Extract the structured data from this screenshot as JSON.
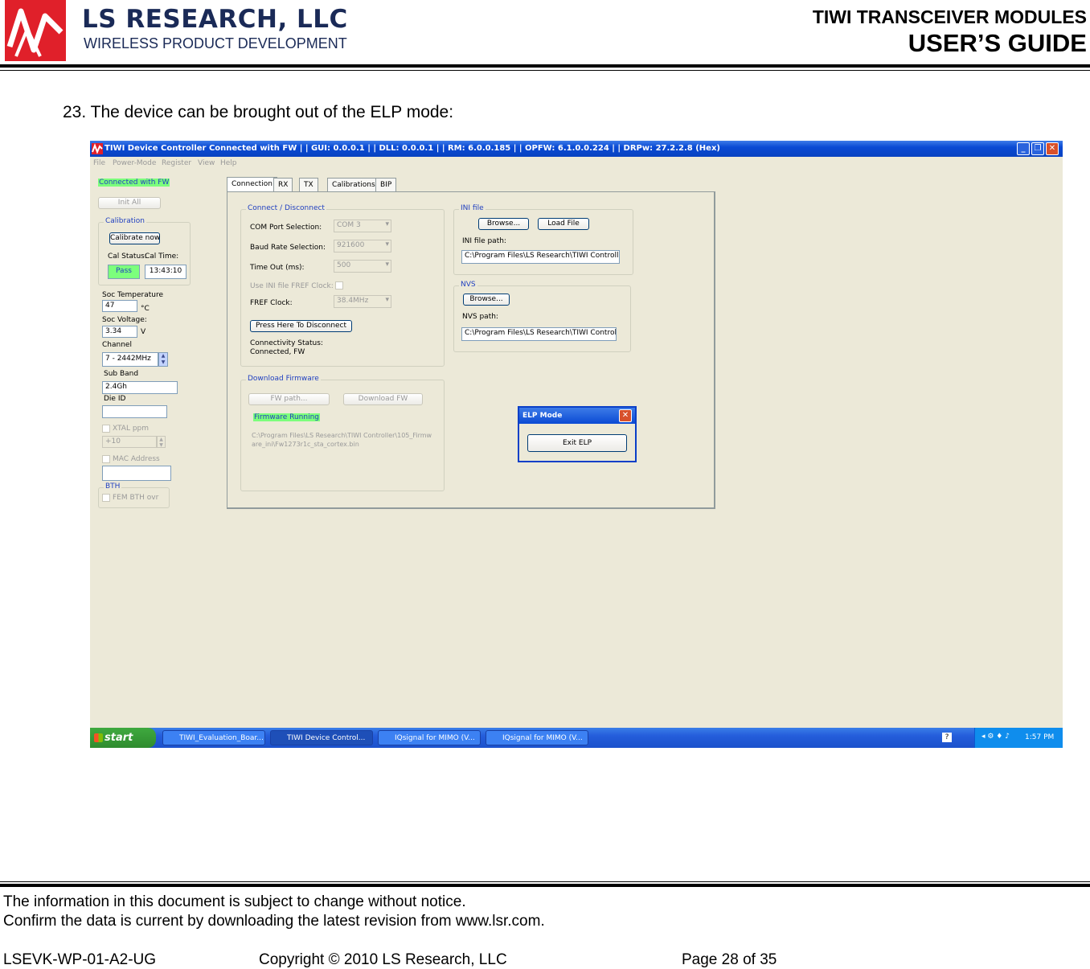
{
  "header": {
    "company": "LS RESEARCH, LLC",
    "tagline": "WIRELESS PRODUCT DEVELOPMENT",
    "title": "TIWI TRANSCEIVER MODULES",
    "subtitle": "USER’S GUIDE",
    "logo_icon": "ls-research-logo",
    "logo_color": "#e0202a"
  },
  "step": "23. The device can be brought out of the ELP mode:",
  "app": {
    "window_title": "TIWI Device Controller Connected with FW | | GUI: 0.0.0.1 | | DLL: 0.0.0.1 | | RM: 6.0.0.185 | | OPFW: 6.1.0.0.224 | | DRPw: 27.2.2.8 (Hex)",
    "menu": [
      "File",
      "Power-Mode",
      "Register",
      "View",
      "Help"
    ],
    "left": {
      "status": "Connected with FW",
      "init_all": "Init All",
      "calibration_group": "Calibration",
      "calibrate_now": "Calibrate now",
      "cal_status_label": "Cal Status:",
      "cal_time_label": "Cal Time:",
      "cal_status": "Pass",
      "cal_time": "13:43:10",
      "soc_temp_label": "Soc Temperature",
      "soc_temp": "47",
      "soc_temp_unit": "°C",
      "soc_voltage_label": "Soc Voltage:",
      "soc_voltage": "3.34",
      "soc_voltage_unit": "V",
      "channel_label": "Channel",
      "channel": "7 - 2442MHz",
      "subband_label": "Sub Band",
      "subband": "2.4Gh",
      "dieid_label": "Die ID",
      "xtal_label": "XTAL ppm",
      "xtal": "+10",
      "mac_label": "MAC Address",
      "bth_group": "BTH",
      "fem_label": "FEM BTH ovr"
    },
    "tabs": [
      "Connection",
      "RX",
      "TX",
      "Calibrations",
      "BIP"
    ],
    "connect": {
      "group": "Connect / Disconnect",
      "com_label": "COM Port Selection:",
      "com": "COM 3",
      "baud_label": "Baud Rate Selection:",
      "baud": "921600",
      "timeout_label": "Time Out (ms):",
      "timeout": "500",
      "ini_fref_label": "Use INI file FREF Clock:",
      "fref_label": "FREF Clock:",
      "fref": "38.4MHz",
      "disconnect_btn": "Press Here To Disconnect",
      "conn_status_label": "Connectivity Status:",
      "conn_status": "Connected, FW"
    },
    "ini": {
      "group": "INI file",
      "browse": "Browse...",
      "load": "Load File",
      "path_label": "INI file path:",
      "path": "C:\\Program Files\\LS Research\\TIWI Controller\\"
    },
    "nvs": {
      "group": "NVS",
      "browse": "Browse...",
      "path_label": "NVS path:",
      "path": "C:\\Program Files\\LS Research\\TIWI Controller"
    },
    "firmware": {
      "group": "Download Firmware",
      "fw_path_btn": "FW path...",
      "download_btn": "Download FW",
      "status": "Firmware Running",
      "path": "C:\\Program Files\\LS Research\\TIWI Controller\\105_Firmware_ini\\Fw1273r1c_sta_cortex.bin"
    },
    "elp": {
      "title": "ELP Mode",
      "exit_btn": "Exit ELP"
    },
    "taskbar": {
      "start": "start",
      "tasks": [
        "TIWI_Evaluation_Boar...",
        "TIWI Device Control...",
        "IQsignal for MIMO (V...",
        "IQsignal for MIMO (V..."
      ],
      "clock": "1:57 PM"
    }
  },
  "footer": {
    "notice1": "The information in this document is subject to change without notice.",
    "notice2": "Confirm the data is current by downloading the latest revision from www.lsr.com.",
    "doc_id": "LSEVK-WP-01-A2-UG",
    "copyright": "Copyright © 2010 LS Research, LLC",
    "page": "Page 28 of 35"
  }
}
